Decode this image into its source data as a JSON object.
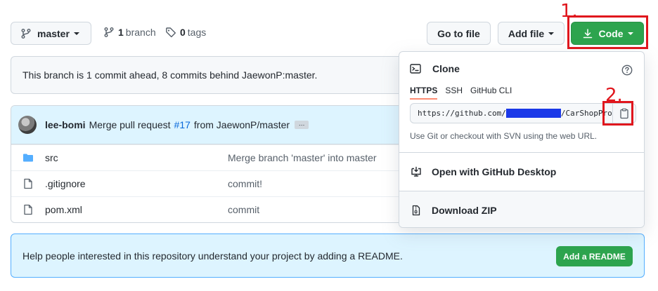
{
  "toolbar": {
    "branch_selector_label": "master",
    "branch_count": "1",
    "branch_word": "branch",
    "tag_count": "0",
    "tag_word": "tags",
    "goto_file_label": "Go to file",
    "add_file_label": "Add file",
    "code_label": "Code"
  },
  "annotations": {
    "step1": "1.",
    "step2": "2.",
    "highlight_color": "#e0161d"
  },
  "ahead_notice": "This branch is 1 commit ahead, 8 commits behind JaewonP:master.",
  "latest_commit": {
    "author": "lee-bomi",
    "message_prefix": "Merge pull request",
    "pr_number": "#17",
    "message_suffix": "from JaewonP/master",
    "ellipsis": "…"
  },
  "files": [
    {
      "name": "src",
      "type": "folder",
      "icon": "folder-icon",
      "message": "Merge branch 'master' into master"
    },
    {
      "name": ".gitignore",
      "type": "file",
      "icon": "file-icon",
      "message": "commit!"
    },
    {
      "name": "pom.xml",
      "type": "file",
      "icon": "file-icon",
      "message": "commit"
    }
  ],
  "readme_notice": {
    "text": "Help people interested in this repository understand your project by adding a README.",
    "button_label": "Add a README"
  },
  "clone_popup": {
    "title": "Clone",
    "tabs": [
      {
        "label": "HTTPS",
        "active": true
      },
      {
        "label": "SSH",
        "active": false
      },
      {
        "label": "GitHub CLI",
        "active": false
      }
    ],
    "url_prefix": "https://github.com/",
    "url_suffix": "/CarShopPro",
    "help_text": "Use Git or checkout with SVN using the web URL.",
    "open_desktop_label": "Open with GitHub Desktop",
    "download_zip_label": "Download ZIP"
  },
  "colors": {
    "primary_green": "#2da44e",
    "link_blue": "#0969da",
    "commit_bg": "#ddf4ff",
    "active_tab_underline": "#fd8c73"
  }
}
